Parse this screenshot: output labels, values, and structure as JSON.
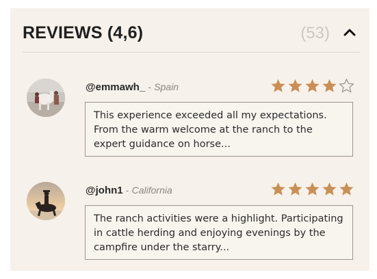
{
  "header": {
    "title": "REVIEWS (4,6)",
    "count": "(53)",
    "toggle_icon": "chevron-up-icon"
  },
  "colors": {
    "star_filled": "#c98f55",
    "star_empty": "#9a948e",
    "panel_bg": "#f6f1ea"
  },
  "reviews": [
    {
      "handle": "@emmawh_",
      "separator": "-",
      "location": "Spain",
      "rating": 4,
      "max_rating": 5,
      "comment": "This experience exceeded all my expectations. From the warm welcome at the ranch to the expert guidance on horse..."
    },
    {
      "handle": "@john1",
      "separator": "-",
      "location": "California",
      "rating": 5,
      "max_rating": 5,
      "comment": "The ranch activities were a highlight. Participating in cattle herding and enjoying evenings by the campfire under the starry..."
    }
  ]
}
